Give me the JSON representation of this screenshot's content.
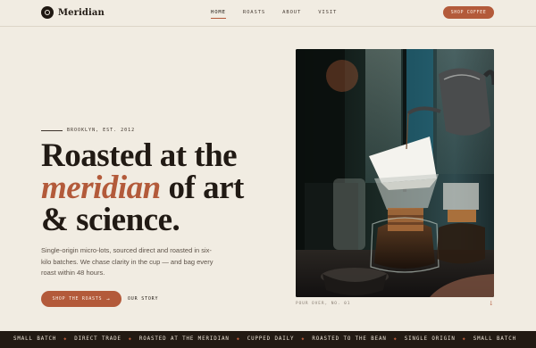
{
  "brand": {
    "name": "Meridian"
  },
  "nav": {
    "links": [
      "HOME",
      "ROASTS",
      "ABOUT",
      "VISIT"
    ],
    "active_index": 0,
    "cta_label": "SHOP COFFEE"
  },
  "hero": {
    "eyebrow": "BROOKLYN, EST. 2012",
    "headline": {
      "line1": "Roasted at the",
      "accent": "meridian",
      "line2_rest": " of art",
      "line3": "& science."
    },
    "description": "Single-origin micro-lots, sourced direct and roasted in six-kilo batches. We chase clarity in the cup — and bag every roast within 48 hours.",
    "primary_button": "SHOP THE ROASTS",
    "primary_arrow": "→",
    "secondary_link": "OUR STORY"
  },
  "photo": {
    "caption": "POUR OVER, NO. 01",
    "scroll_icon": "↓"
  },
  "ticker": {
    "items": [
      "SMALL BATCH",
      "DIRECT TRADE",
      "ROASTED AT THE MERIDIAN",
      "CUPPED DAILY",
      "ROASTED TO THE BEAN",
      "SINGLE ORIGIN",
      "SMALL BATCH"
    ],
    "separator": "◆"
  },
  "colors": {
    "background": "#f1ece2",
    "accent": "#b35a3a",
    "ink": "#211a14",
    "ticker_bg": "#221a13"
  }
}
